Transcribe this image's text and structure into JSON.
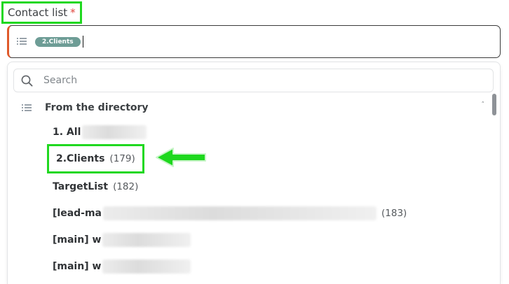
{
  "field": {
    "label": "Contact list",
    "required_mark": "*",
    "selected_chip": "2.Clients"
  },
  "dropdown": {
    "search_placeholder": "Search",
    "group_title": "From the directory",
    "items": [
      {
        "name": "1. All",
        "count": ""
      },
      {
        "name": "2.Clients",
        "count": "(179)"
      },
      {
        "name": "TargetList",
        "count": "(182)"
      },
      {
        "name": "[lead-ma",
        "count": "(183)"
      },
      {
        "name": "[main] w",
        "count": ""
      },
      {
        "name": "[main] w",
        "count": ""
      }
    ]
  },
  "colors": {
    "highlight": "#20d820",
    "chip": "#6e9d96",
    "required": "#e0483e",
    "select_accent": "#e05a2b"
  },
  "icons": {
    "list": "list-icon",
    "search": "search-icon",
    "collapse": "chevron-up-icon",
    "pointer": "arrow-left-icon"
  }
}
